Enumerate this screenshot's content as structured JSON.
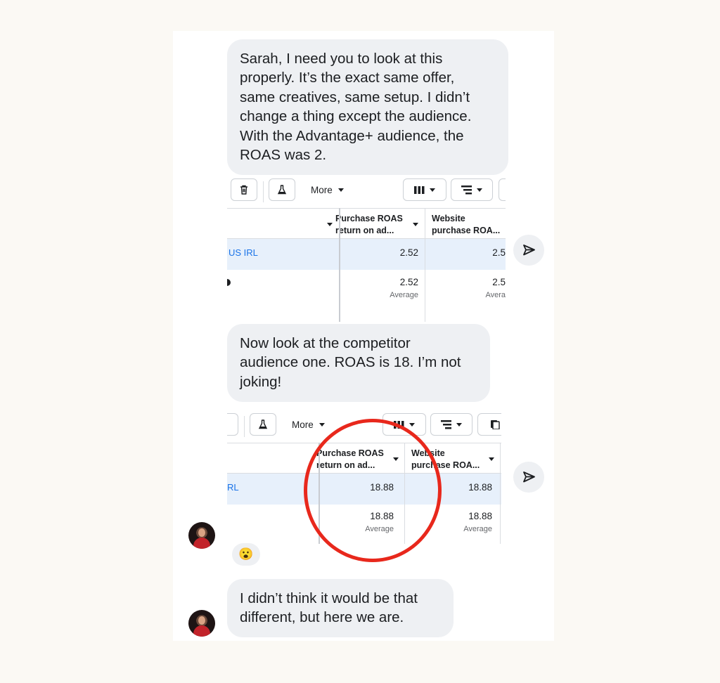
{
  "messages": [
    {
      "text": "Sarah, I need you to look at this\nproperly. It’s the exact same offer,\nsame creatives, same setup. I didn’t\nchange a thing except the audience.\nWith the Advantage+ audience, the\nROAS was 2."
    },
    {
      "text": "Now look at the competitor\naudience one. ROAS is 18. I’m not\njoking!"
    },
    {
      "text": "I didn’t think it would be that\ndifferent, but here we are."
    }
  ],
  "screenshot_1": {
    "toolbar": {
      "more_label": "More"
    },
    "columns": [
      {
        "line1": "Purchase ROAS",
        "line2": "return on ad..."
      },
      {
        "line1": "Website",
        "line2": "purchase ROA..."
      }
    ],
    "campaign_name": "US IRL",
    "row_values": [
      "2.52",
      "2.5"
    ],
    "summary_values": [
      "2.52",
      "2.5"
    ],
    "summary_labels": [
      "Average",
      "Avera"
    ]
  },
  "screenshot_2": {
    "toolbar": {
      "more_label": "More"
    },
    "columns": [
      {
        "line1": "Purchase ROAS",
        "line2": "return on ad..."
      },
      {
        "line1": "Website",
        "line2": "purchase ROA..."
      }
    ],
    "campaign_name": "RL",
    "row_values": [
      "18.88",
      "18.88"
    ],
    "summary_values": [
      "18.88",
      "18.88"
    ],
    "summary_labels": [
      "Average",
      "Average"
    ]
  },
  "reaction_emoji": "😮",
  "colors": {
    "highlight_circle": "#e8281c",
    "bubble": "#eef0f3",
    "link": "#1a73e8",
    "selected_row": "#e7f0fb"
  }
}
